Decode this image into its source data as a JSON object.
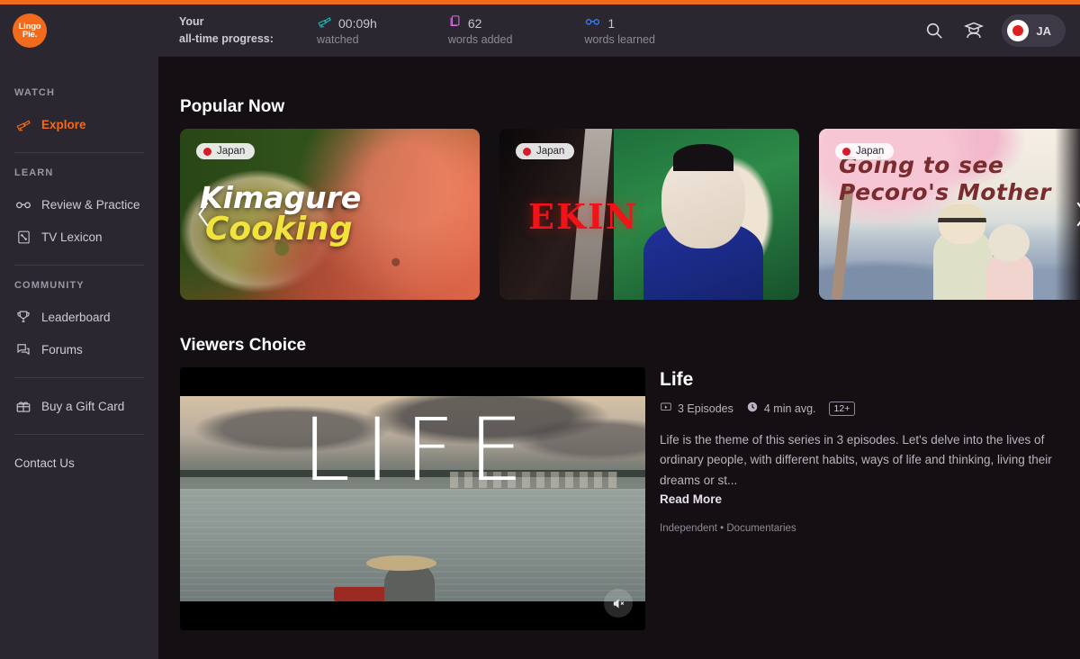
{
  "brand": {
    "logo_line1": "Lingo",
    "logo_line2": "Pie."
  },
  "header": {
    "progress_line1": "Your",
    "progress_line2": "all-time progress:",
    "stats": [
      {
        "icon": "telescope-icon",
        "value": "00:09h",
        "label": "watched"
      },
      {
        "icon": "cards-icon",
        "value": "62",
        "label": "words added"
      },
      {
        "icon": "glasses-icon",
        "value": "1",
        "label": "words learned"
      }
    ],
    "search_icon": "search-icon",
    "graduate_icon": "graduate-icon",
    "language": {
      "code": "JA",
      "flag": "japan-flag"
    }
  },
  "sidebar": {
    "groups": [
      {
        "heading": "WATCH",
        "items": [
          {
            "label": "Explore",
            "icon": "telescope-icon",
            "active": true
          }
        ]
      },
      {
        "heading": "LEARN",
        "items": [
          {
            "label": "Review & Practice",
            "icon": "glasses-icon",
            "active": false
          },
          {
            "label": "TV Lexicon",
            "icon": "lexicon-book-icon",
            "active": false
          }
        ]
      },
      {
        "heading": "COMMUNITY",
        "items": [
          {
            "label": "Leaderboard",
            "icon": "trophy-icon",
            "active": false
          },
          {
            "label": "Forums",
            "icon": "chat-icon",
            "active": false
          }
        ]
      }
    ],
    "gift_card": {
      "label": "Buy a Gift Card",
      "icon": "gift-icon"
    },
    "contact": {
      "label": "Contact Us"
    }
  },
  "popular": {
    "title": "Popular Now",
    "prev_icon": "chevron-left-icon",
    "next_icon": "chevron-right-icon",
    "cards": [
      {
        "badge": "Japan",
        "title_line1": "Kimagure",
        "title_line2": "Cooking"
      },
      {
        "badge": "Japan",
        "title_line1": "EKIN",
        "title_line2": ""
      },
      {
        "badge": "Japan",
        "title_line1": "Going to see",
        "title_line2": "Pecoro's Mother"
      }
    ]
  },
  "viewers_choice": {
    "title": "Viewers Choice",
    "player": {
      "overlay_text": "LIFE",
      "mute_icon": "mute-icon"
    },
    "show": {
      "title": "Life",
      "episodes": "3 Episodes",
      "duration": "4 min avg.",
      "rating": "12+",
      "description": "Life is the theme of this series in 3 episodes. Let's delve into the lives of ordinary people, with different habits, ways of life and thinking, living their dreams or st...",
      "read_more": "Read More",
      "genres": "Independent • Documentaries"
    }
  },
  "colors": {
    "accent": "#f26a1b",
    "sidebar_bg": "#2a2730",
    "content_bg": "#140f13",
    "flag_red": "#d91a2a"
  }
}
